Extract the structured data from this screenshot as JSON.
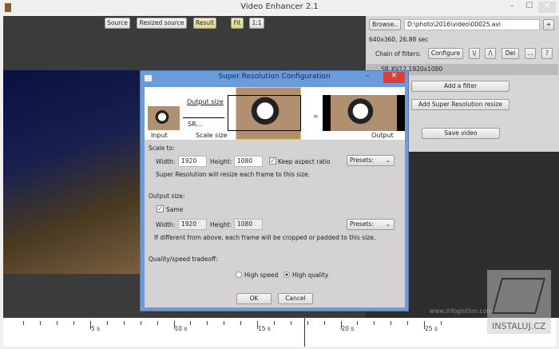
{
  "window": {
    "title": "Video Enhancer 2.1",
    "min": "–",
    "max": "☐",
    "close": "✕"
  },
  "viewer": {
    "buttons": [
      "Source",
      "Resized source",
      "Result",
      "Fit",
      "1:1"
    ],
    "watermark": "www.infognition.com"
  },
  "panel": {
    "browse": "Browse..",
    "path": "D:\\photo\\2016\\video\\00025.avi",
    "add": "+",
    "info": "640x360, 26.88 sec",
    "chain_label": "Chain of filters:",
    "configure": "Configure",
    "down": "\\/",
    "up": "/\\",
    "del": "Del",
    "more": "...",
    "help": "?",
    "filter_item": "SR XV12 1920x1080",
    "add_filter": "Add a filter",
    "add_sr": "Add Super Resolution resize",
    "save": "Save video"
  },
  "dialog": {
    "title": "Super Resolution Configuration",
    "close": "✕",
    "strip": {
      "input": "Input",
      "output_size": "Output size",
      "sr": "SR...",
      "scale_size": "Scale size",
      "equals": "=",
      "output": "Output"
    },
    "scale_to": "Scale to:",
    "width_label": "Width:",
    "height_label": "Height:",
    "scale_width": "1920",
    "scale_height": "1080",
    "keep_aspect": "Keep aspect ratio",
    "presets": "Presets:",
    "scale_note": "Super Resolution will resize each frame to this size.",
    "output_size": "Output size:",
    "same": "Same",
    "out_width": "1920",
    "out_height": "1080",
    "out_note": "If different from above, each frame will be cropped or padded to this size.",
    "quality_label": "Quality/speed tradeoff:",
    "high_speed": "High speed",
    "high_quality": "High quality",
    "ok": "OK",
    "cancel": "Cancel"
  },
  "timeline": {
    "labels": [
      "5 s",
      "10 s",
      "15 s",
      "20 s",
      "25 s"
    ],
    "position_sec": 17.8
  },
  "logo": "INSTALUJ.CZ"
}
